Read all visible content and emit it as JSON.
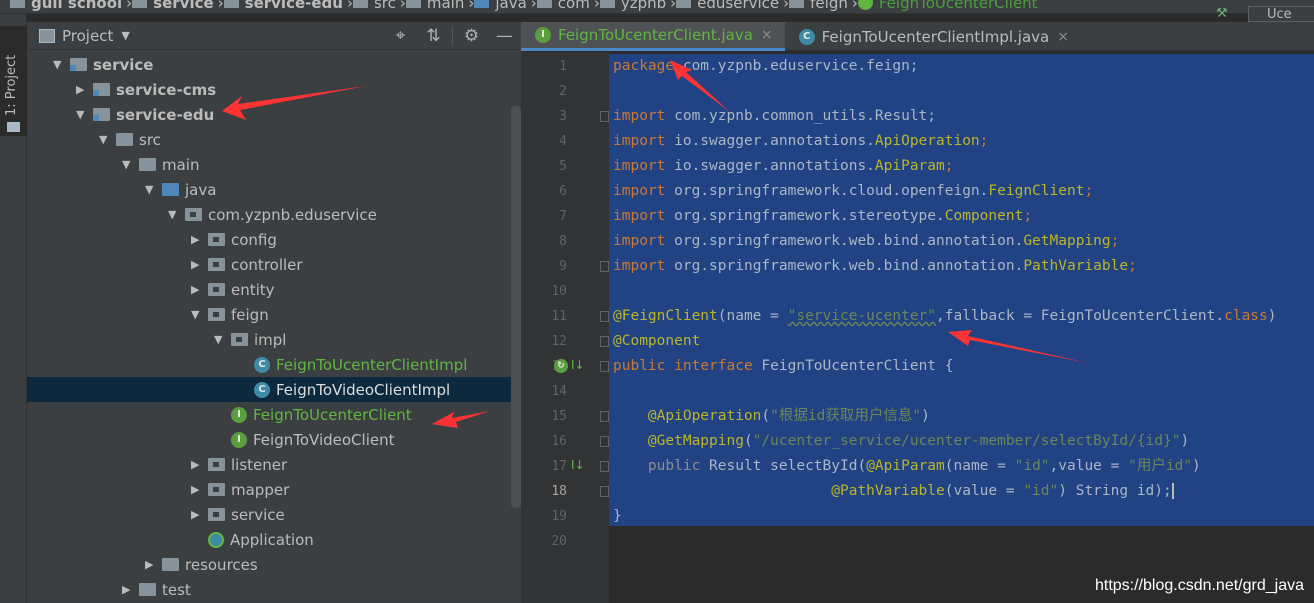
{
  "breadcrumb": {
    "items": [
      "guli school",
      "service",
      "service-edu",
      "src",
      "main",
      "java",
      "com",
      "yzpnb",
      "eduservice",
      "feign",
      "FeignToUcenterClient"
    ],
    "right_box": "Uce"
  },
  "toolstrip": {
    "project_tab": "1: Project"
  },
  "project_panel": {
    "title": "Project",
    "tools": [
      "target-icon",
      "collapse-icon",
      "gear-icon",
      "minimize-icon"
    ]
  },
  "tree": [
    {
      "label": "service",
      "depth": 0,
      "open": true,
      "kind": "module",
      "bold": true
    },
    {
      "label": "service-cms",
      "depth": 1,
      "open": false,
      "kind": "module",
      "bold": true
    },
    {
      "label": "service-edu",
      "depth": 1,
      "open": true,
      "kind": "module",
      "bold": true
    },
    {
      "label": "src",
      "depth": 2,
      "open": true,
      "kind": "folder"
    },
    {
      "label": "main",
      "depth": 3,
      "open": true,
      "kind": "folder"
    },
    {
      "label": "java",
      "depth": 4,
      "open": true,
      "kind": "src"
    },
    {
      "label": "com.yzpnb.eduservice",
      "depth": 5,
      "open": true,
      "kind": "pkg"
    },
    {
      "label": "config",
      "depth": 6,
      "open": false,
      "kind": "pkg"
    },
    {
      "label": "controller",
      "depth": 6,
      "open": false,
      "kind": "pkg"
    },
    {
      "label": "entity",
      "depth": 6,
      "open": false,
      "kind": "pkg"
    },
    {
      "label": "feign",
      "depth": 6,
      "open": true,
      "kind": "pkg"
    },
    {
      "label": "impl",
      "depth": 7,
      "open": true,
      "kind": "pkg"
    },
    {
      "label": "FeignToUcenterClientImpl",
      "depth": 8,
      "kind": "class",
      "color": "green"
    },
    {
      "label": "FeignToVideoClientImpl",
      "depth": 8,
      "kind": "class",
      "selected": true,
      "color": "white"
    },
    {
      "label": "FeignToUcenterClient",
      "depth": 7,
      "kind": "interface",
      "color": "green"
    },
    {
      "label": "FeignToVideoClient",
      "depth": 7,
      "kind": "interface"
    },
    {
      "label": "listener",
      "depth": 6,
      "open": false,
      "kind": "pkg"
    },
    {
      "label": "mapper",
      "depth": 6,
      "open": false,
      "kind": "pkg"
    },
    {
      "label": "service",
      "depth": 6,
      "open": false,
      "kind": "pkg"
    },
    {
      "label": "Application",
      "depth": 6,
      "kind": "app"
    },
    {
      "label": "resources",
      "depth": 4,
      "open": false,
      "kind": "res"
    },
    {
      "label": "test",
      "depth": 3,
      "open": false,
      "kind": "folder"
    }
  ],
  "editor_tabs": [
    {
      "label": "FeignToUcenterClient.java",
      "active": true,
      "icon": "I",
      "close": "×"
    },
    {
      "label": "FeignToUcenterClientImpl.java",
      "active": false,
      "icon": "C",
      "close": "×"
    }
  ],
  "code": {
    "line_numbers": [
      "1",
      "2",
      "3",
      "4",
      "5",
      "6",
      "7",
      "8",
      "9",
      "10",
      "11",
      "12",
      "13",
      "14",
      "15",
      "16",
      "17",
      "18",
      "19",
      "20"
    ],
    "current_line": "18",
    "l1_kw": "package",
    "l1_rest": " com.yzpnb.eduservice.feign;",
    "imp": "import",
    "l3": " com.yzpnb.common_utils.Result;",
    "l4a": " io.swagger.annotations.",
    "l4b": "ApiOperation",
    "l4c": ";",
    "l5a": " io.swagger.annotations.",
    "l5b": "ApiParam",
    "l5c": ";",
    "l6a": " org.springframework.cloud.openfeign.",
    "l6b": "FeignClient",
    "l6c": ";",
    "l7a": " org.springframework.stereotype.",
    "l7b": "Component",
    "l7c": ";",
    "l8a": " org.springframework.web.bind.annotation.",
    "l8b": "GetMapping",
    "l8c": ";",
    "l9a": " org.springframework.web.bind.annotation.",
    "l9b": "PathVariable",
    "l9c": ";",
    "l11_ann": "@FeignClient",
    "l11_a": "(name = ",
    "l11_str": "\"service-ucenter\"",
    "l11_b": ",fallback = FeignToUcenterClient.",
    "l11_kw": "class",
    "l11_c": ")",
    "l12_ann": "@Component",
    "l13_kw1": "public",
    "l13_kw2": "interface",
    "l13_rest": " FeignToUcenterClient {",
    "l15_ann": "@ApiOperation",
    "l15_a": "(",
    "l15_str": "\"根据id获取用户信息\"",
    "l15_b": ")",
    "l16_ann": "@GetMapping",
    "l16_a": "(",
    "l16_str": "\"/ucenter_service/ucenter-member/selectById/{id}\"",
    "l16_b": ")",
    "l17_kw": "public",
    "l17_a": " Result selectById(",
    "l17_ann": "@ApiParam",
    "l17_b": "(name = ",
    "l17_s1": "\"id\"",
    "l17_c": ",value = ",
    "l17_s2": "\"用户id\"",
    "l17_d": ")",
    "l18_ann": "@PathVariable",
    "l18_a": "(value = ",
    "l18_s": "\"id\"",
    "l18_b": ") String id);",
    "l19": "}"
  },
  "watermark": "https://blog.csdn.net/grd_java",
  "colors": {
    "selection": "#214283",
    "annotation_arrow": "#ff3333"
  }
}
